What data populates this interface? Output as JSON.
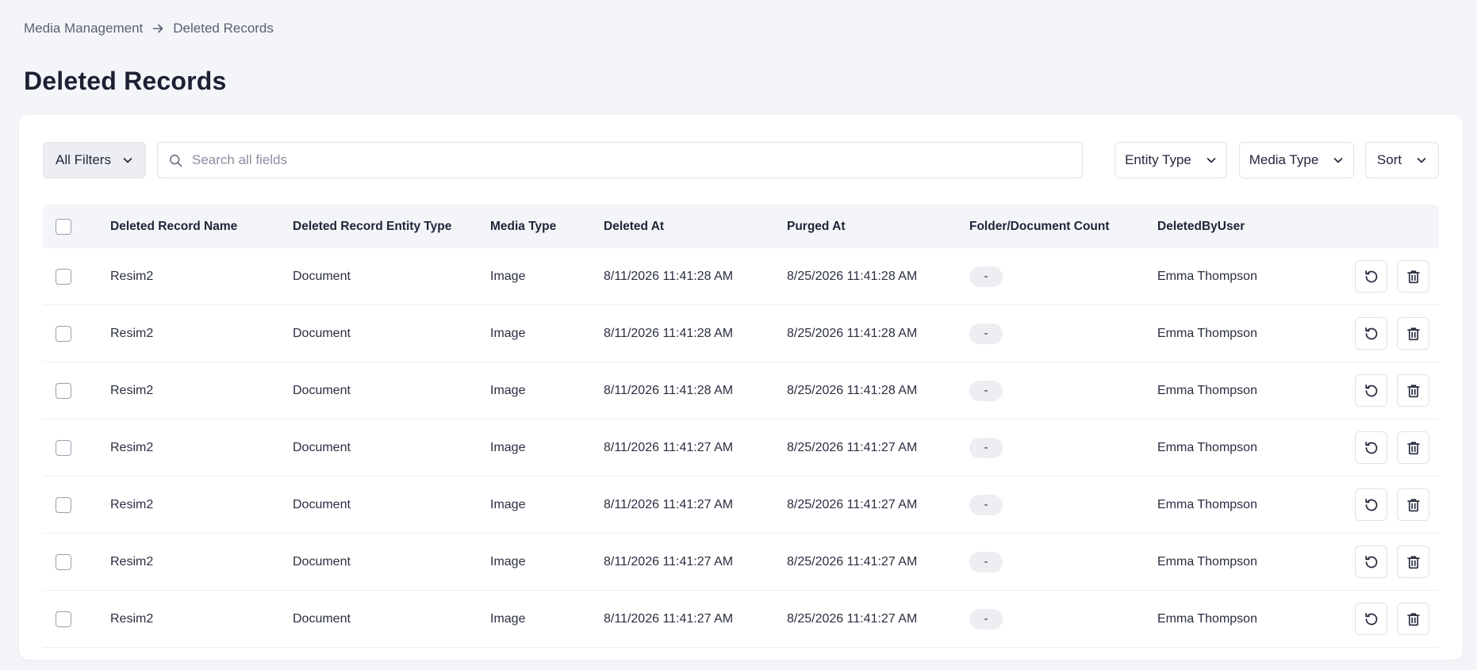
{
  "breadcrumb": {
    "parent": "Media Management",
    "current": "Deleted Records"
  },
  "page_title": "Deleted Records",
  "toolbar": {
    "all_filters_label": "All Filters",
    "search_placeholder": "Search all fields",
    "entity_type_label": "Entity Type",
    "media_type_label": "Media Type",
    "sort_label": "Sort"
  },
  "table": {
    "headers": {
      "name": "Deleted Record Name",
      "entity": "Deleted Record Entity Type",
      "media": "Media Type",
      "deleted": "Deleted At",
      "purged": "Purged At",
      "count": "Folder/Document Count",
      "user": "DeletedByUser"
    },
    "rows": [
      {
        "name": "Resim2",
        "entity": "Document",
        "media": "Image",
        "deleted": "8/11/2026 11:41:28 AM",
        "purged": "8/25/2026 11:41:28 AM",
        "count": "-",
        "user": "Emma Thompson"
      },
      {
        "name": "Resim2",
        "entity": "Document",
        "media": "Image",
        "deleted": "8/11/2026 11:41:28 AM",
        "purged": "8/25/2026 11:41:28 AM",
        "count": "-",
        "user": "Emma Thompson"
      },
      {
        "name": "Resim2",
        "entity": "Document",
        "media": "Image",
        "deleted": "8/11/2026 11:41:28 AM",
        "purged": "8/25/2026 11:41:28 AM",
        "count": "-",
        "user": "Emma Thompson"
      },
      {
        "name": "Resim2",
        "entity": "Document",
        "media": "Image",
        "deleted": "8/11/2026 11:41:27 AM",
        "purged": "8/25/2026 11:41:27 AM",
        "count": "-",
        "user": "Emma Thompson"
      },
      {
        "name": "Resim2",
        "entity": "Document",
        "media": "Image",
        "deleted": "8/11/2026 11:41:27 AM",
        "purged": "8/25/2026 11:41:27 AM",
        "count": "-",
        "user": "Emma Thompson"
      },
      {
        "name": "Resim2",
        "entity": "Document",
        "media": "Image",
        "deleted": "8/11/2026 11:41:27 AM",
        "purged": "8/25/2026 11:41:27 AM",
        "count": "-",
        "user": "Emma Thompson"
      },
      {
        "name": "Resim2",
        "entity": "Document",
        "media": "Image",
        "deleted": "8/11/2026 11:41:27 AM",
        "purged": "8/25/2026 11:41:27 AM",
        "count": "-",
        "user": "Emma Thompson"
      }
    ]
  },
  "icons": {
    "breadcrumb_sep": "arrow-right-icon",
    "dropdown": "chevron-down-icon",
    "search": "search-icon",
    "restore": "restore-icon",
    "delete": "trash-icon"
  },
  "colors": {
    "background": "#f4f5f9",
    "card": "#ffffff",
    "text": "#1f2437",
    "muted": "#5b6072"
  }
}
